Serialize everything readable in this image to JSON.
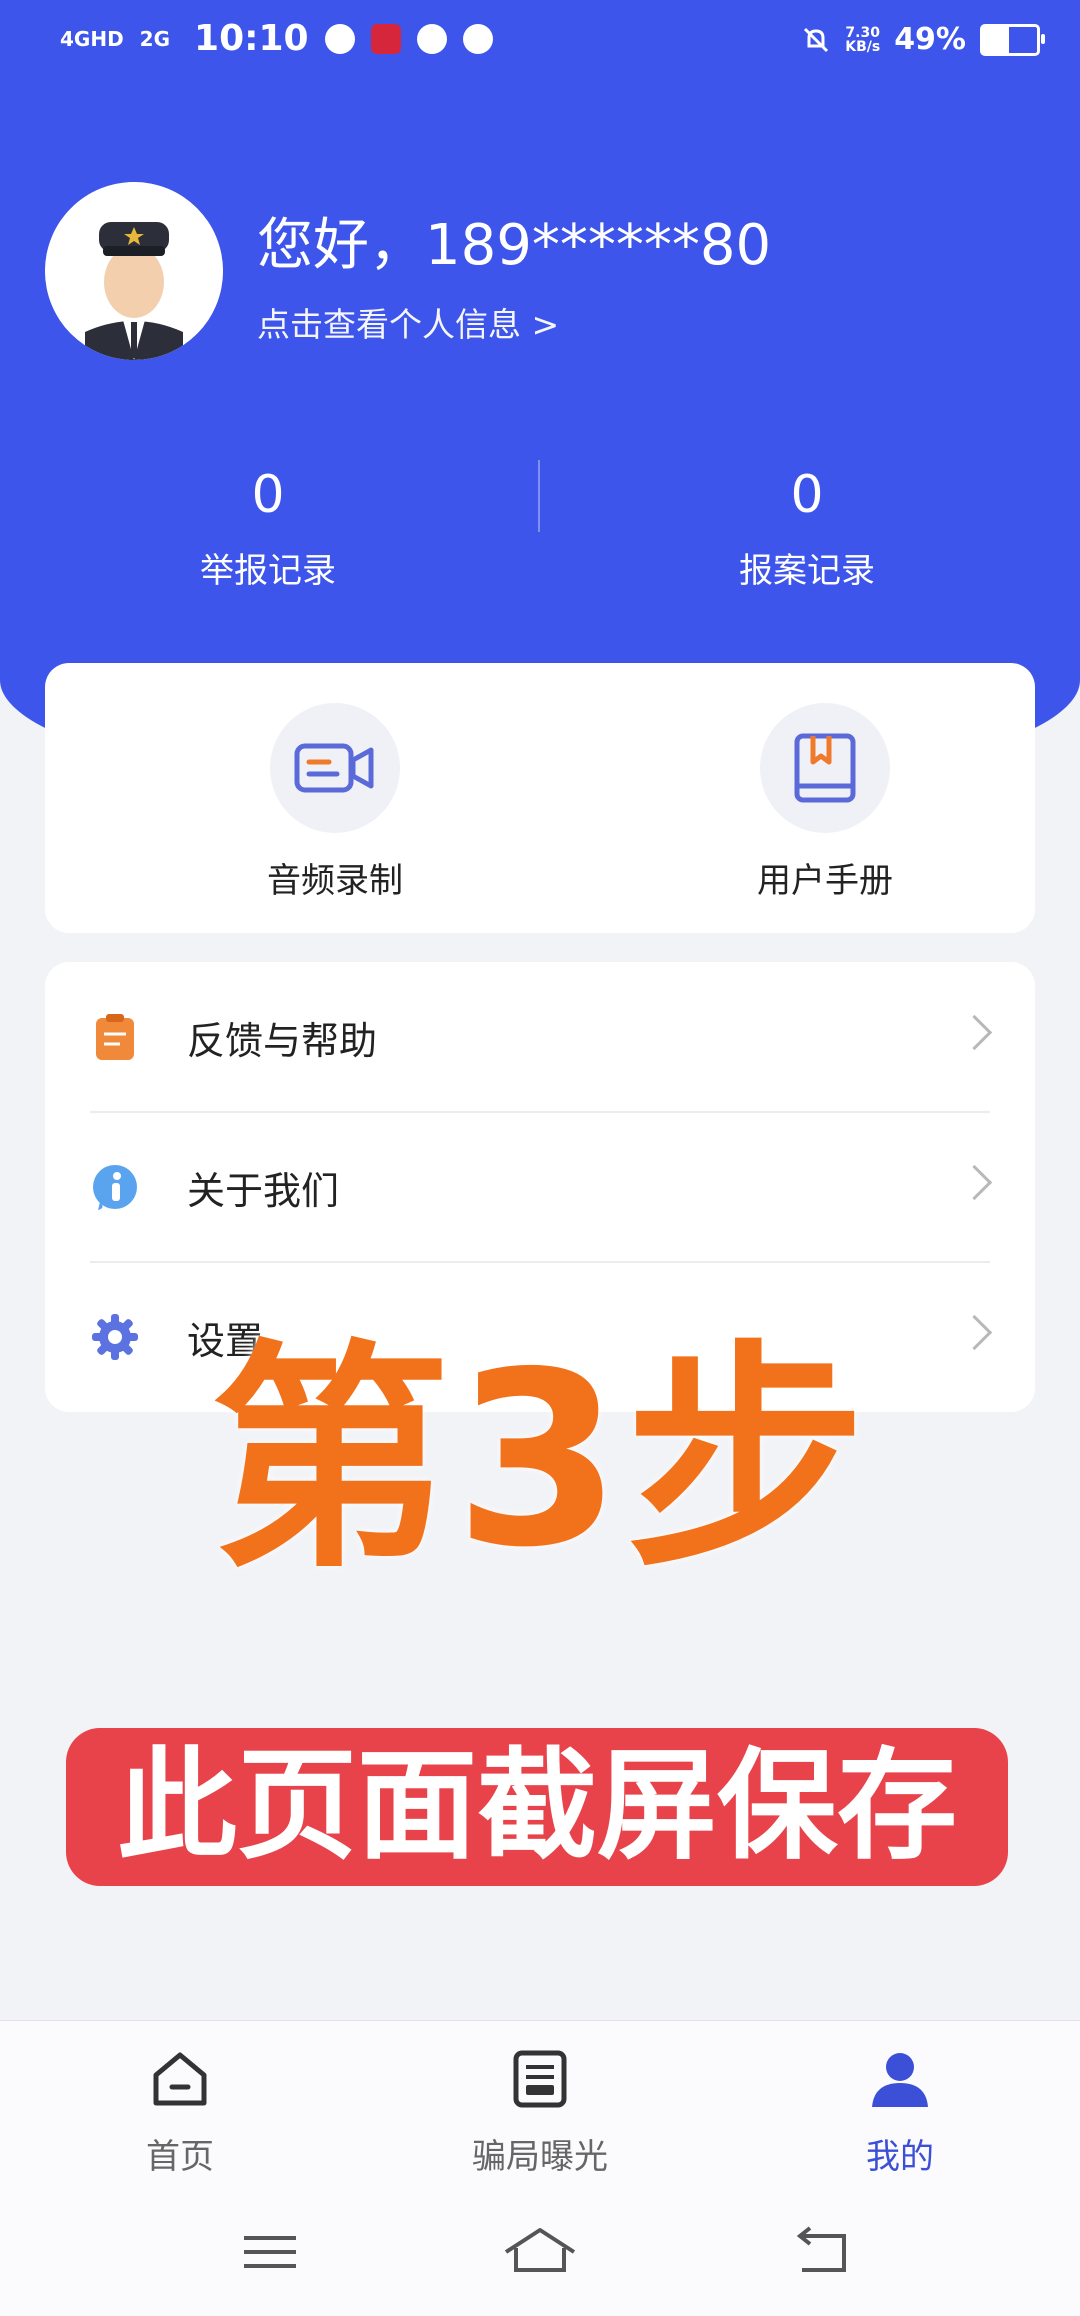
{
  "status_bar": {
    "network_1": "4GHD",
    "network_2": "2G",
    "time": "10:10",
    "speed": "7.30",
    "speed_unit": "KB/s",
    "battery": "49%",
    "battery_level": 0.49
  },
  "profile": {
    "greeting": "您好，189******80",
    "view_info": "点击查看个人信息 >"
  },
  "stats": [
    {
      "value": "0",
      "label": "举报记录"
    },
    {
      "value": "0",
      "label": "报案记录"
    }
  ],
  "quick_actions": [
    {
      "label": "音频录制",
      "icon": "video-camera-icon"
    },
    {
      "label": "用户手册",
      "icon": "book-icon"
    }
  ],
  "menu": [
    {
      "label": "反馈与帮助",
      "icon": "clipboard-icon"
    },
    {
      "label": "关于我们",
      "icon": "info-icon"
    },
    {
      "label": "设置",
      "icon": "gear-icon"
    }
  ],
  "overlay": {
    "step_text": "第3步",
    "save_text": "此页面截屏保存"
  },
  "tabs": [
    {
      "label": "首页",
      "icon": "home-icon"
    },
    {
      "label": "骗局曝光",
      "icon": "news-icon"
    },
    {
      "label": "我的",
      "icon": "user-icon"
    }
  ],
  "colors": {
    "primary": "#3d55ea",
    "step_orange": "#f2721b",
    "banner_red": "#e8424a",
    "tab_active": "#3b50d6"
  }
}
